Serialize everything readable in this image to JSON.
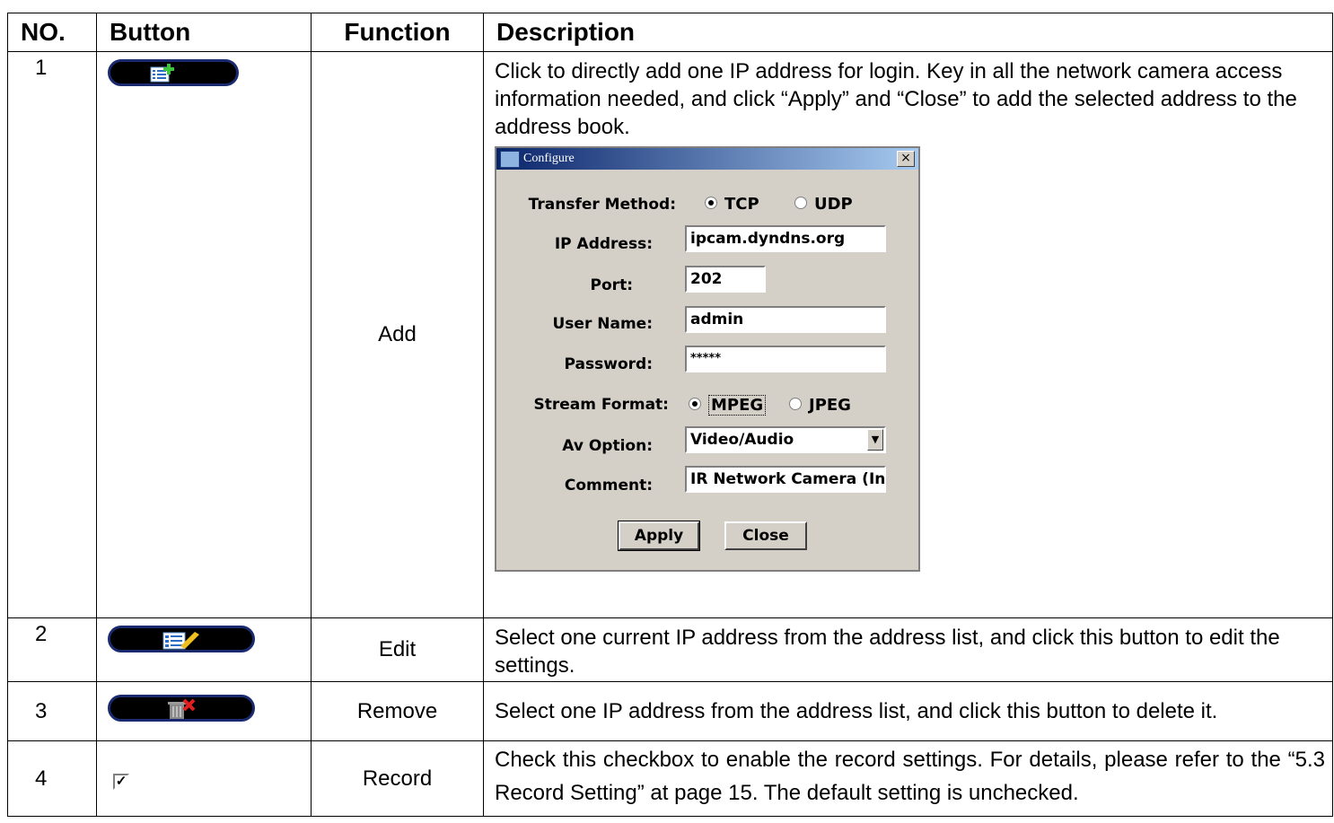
{
  "headers": {
    "no": "NO.",
    "button": "Button",
    "function": "Function",
    "description": "Description"
  },
  "rows": [
    {
      "no": "1",
      "button_icon": "add-address-icon",
      "function": "Add",
      "description": "Click to directly add one IP address for login. Key in all the network camera access information needed, and click “Apply” and “Close” to add the selected address to the address book."
    },
    {
      "no": "2",
      "button_icon": "edit-address-icon",
      "function": "Edit",
      "description": "Select one current IP address from the address list, and click this button to edit the settings."
    },
    {
      "no": "3",
      "button_icon": "remove-address-icon",
      "function": "Remove",
      "description": "Select one IP address from the address list, and click this button to delete it."
    },
    {
      "no": "4",
      "button_icon": "checkbox-icon",
      "function": "Record",
      "description": "Check this checkbox to enable the record settings. For details, please refer to the “5.3 Record Setting” at page 15. The default setting is unchecked."
    }
  ],
  "dialog": {
    "title": "Configure",
    "close_glyph": "×",
    "transfer_label": "Transfer Method:",
    "transfer_options": [
      "TCP",
      "UDP"
    ],
    "transfer_selected": "TCP",
    "ip_label": "IP Address:",
    "ip_value": "ipcam.dyndns.org",
    "port_label": "Port:",
    "port_value": "202",
    "user_label": "User Name:",
    "user_value": "admin",
    "password_label": "Password:",
    "password_value": "*****",
    "stream_label": "Stream Format:",
    "stream_options": [
      "MPEG",
      "JPEG"
    ],
    "stream_selected": "MPEG",
    "av_label": "Av Option:",
    "av_value": "Video/Audio",
    "comment_label": "Comment:",
    "comment_value": "IR Network Camera (In",
    "apply_label": "Apply",
    "close_label": "Close"
  },
  "checkbox_mark": "✓",
  "colors": {
    "pill": "#000000",
    "pill_border": "#1a2a6e",
    "title_bar": "#0a246a",
    "plus": "#3cc43c",
    "cross": "#e02020",
    "pencil": "#f0c020"
  }
}
